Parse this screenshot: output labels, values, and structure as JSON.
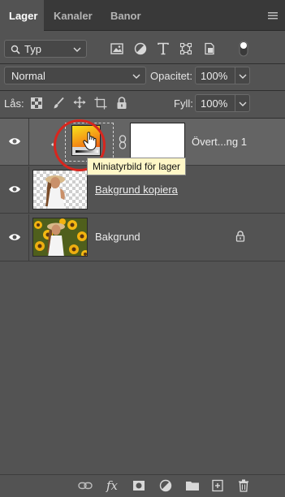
{
  "tabs": [
    {
      "label": "Lager",
      "active": true
    },
    {
      "label": "Kanaler",
      "active": false
    },
    {
      "label": "Banor",
      "active": false
    }
  ],
  "filter": {
    "kind_label": "Typ"
  },
  "blend": {
    "mode": "Normal",
    "opacity_label": "Opacitet:",
    "opacity_value": "100%"
  },
  "lock": {
    "label": "Lås:",
    "fill_label": "Fyll:",
    "fill_value": "100%"
  },
  "layers": [
    {
      "name": "Övert...ng 1",
      "type": "adjustment",
      "selected": true
    },
    {
      "name": "Bakgrund kopiera",
      "type": "image",
      "underlined": true
    },
    {
      "name": "Bakgrund",
      "type": "image",
      "locked": true
    }
  ],
  "tooltip": "Miniatyrbild för lager",
  "bottom_bar": {
    "fx_label": "fx"
  },
  "colors": {
    "panel": "#535353",
    "tabbar": "#393939",
    "selected_row": "#646464",
    "annotation": "#d8261e",
    "tooltip_bg": "#fff7c7"
  }
}
